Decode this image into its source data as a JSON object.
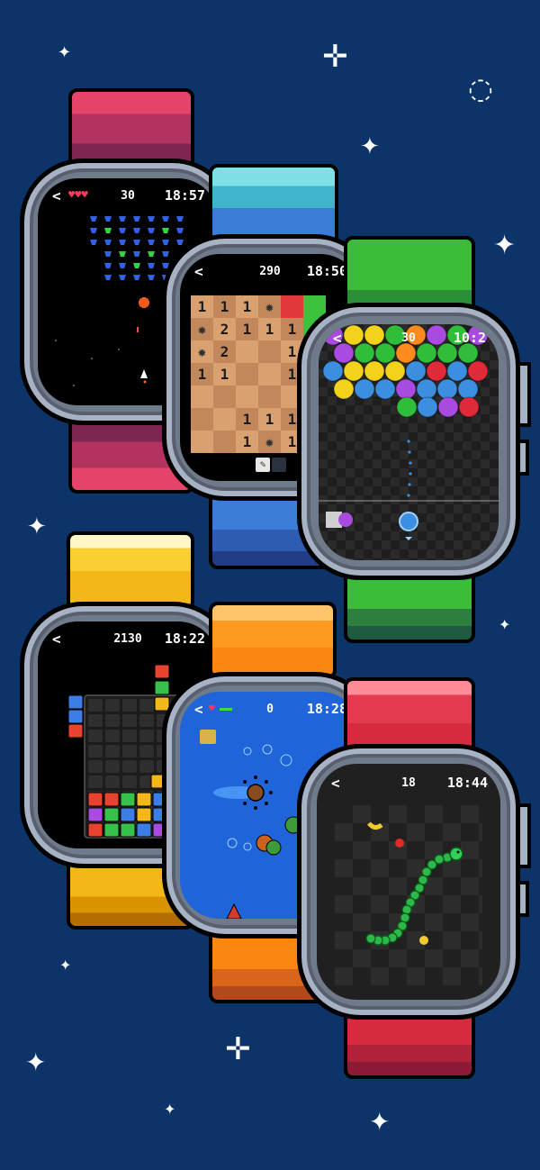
{
  "watches": [
    {
      "id": "space",
      "score": "30",
      "time": "18:57",
      "back": "<",
      "hearts": "♥♥♥"
    },
    {
      "id": "mines",
      "score": "290",
      "time": "18:50",
      "back": "<",
      "grid": [
        [
          "1",
          "1",
          "1",
          "*",
          "",
          ""
        ],
        [
          "*",
          "2",
          "1",
          "1",
          "1",
          ""
        ],
        [
          "*",
          "2",
          "",
          "",
          "1",
          ""
        ],
        [
          "1",
          "1",
          "",
          "",
          "1",
          ""
        ],
        [
          "",
          "",
          "",
          "",
          "",
          ""
        ],
        [
          "",
          "",
          "1",
          "1",
          "1",
          ""
        ],
        [
          "",
          "",
          "1",
          "*",
          "1",
          ""
        ]
      ]
    },
    {
      "id": "bubble",
      "score": "30",
      "time": "10:2",
      "back": "<"
    },
    {
      "id": "blocks",
      "score": "2130",
      "time": "18:22",
      "back": "<"
    },
    {
      "id": "boat",
      "score": "0",
      "time": "18:28",
      "back": "<"
    },
    {
      "id": "snake",
      "score": "18",
      "time": "18:44",
      "back": "<"
    }
  ],
  "colors": {
    "background": "#0d3468",
    "red_band": "#b23360",
    "blue_band": "#3a7cd6",
    "green_band": "#3bbd3a",
    "yellow_band": "#f2b817",
    "orange_band": "#f98712",
    "snake_band": "#d62a3f"
  },
  "icons": [
    "sparkle-icon",
    "back-chevron-icon",
    "heart-icon",
    "mine-icon",
    "flag-icon",
    "shovel-icon"
  ]
}
